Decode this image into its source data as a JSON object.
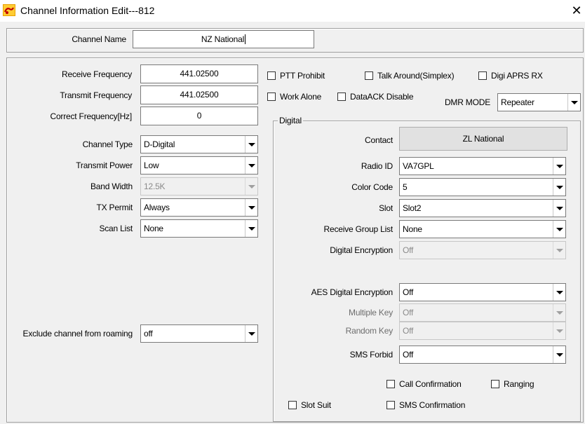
{
  "window": {
    "title": "Channel Information Edit---812",
    "close_glyph": "✕"
  },
  "channel_name": {
    "label": "Channel Name",
    "value": "NZ National"
  },
  "frequency": {
    "receive_label": "Receive Frequency",
    "receive_value": "441.02500",
    "transmit_label": "Transmit Frequency",
    "transmit_value": "441.02500",
    "correct_label": "Correct Frequency[Hz]",
    "correct_value": "0"
  },
  "left_combos": {
    "channel_type": {
      "label": "Channel Type",
      "value": "D-Digital"
    },
    "transmit_power": {
      "label": "Transmit Power",
      "value": "Low"
    },
    "band_width": {
      "label": "Band Width",
      "value": "12.5K"
    },
    "tx_permit": {
      "label": "TX Permit",
      "value": "Always"
    },
    "scan_list": {
      "label": "Scan List",
      "value": "None"
    },
    "exclude_roaming": {
      "label": "Exclude channel from roaming",
      "value": "off"
    }
  },
  "checkboxes": {
    "ptt_prohibit": "PTT Prohibit",
    "talk_around": "Talk Around(Simplex)",
    "digi_aprs_rx": "Digi APRS RX",
    "work_alone": "Work Alone",
    "dataack_disable": "DataACK Disable",
    "call_confirmation": "Call Confirmation",
    "ranging": "Ranging",
    "slot_suit": "Slot Suit",
    "sms_confirmation": "SMS Confirmation"
  },
  "dmr_mode": {
    "label": "DMR MODE",
    "value": "Repeater"
  },
  "digital": {
    "group_title": "Digital",
    "contact_label": "Contact",
    "contact_button": "ZL National",
    "radio_id": {
      "label": "Radio ID",
      "value": "VA7GPL"
    },
    "color_code": {
      "label": "Color Code",
      "value": "5"
    },
    "slot": {
      "label": "Slot",
      "value": "Slot2"
    },
    "receive_group_list": {
      "label": "Receive Group List",
      "value": "None"
    },
    "digital_encryption": {
      "label": "Digital Encryption",
      "value": "Off"
    },
    "aes_encryption": {
      "label": "AES Digital Encryption",
      "value": "Off"
    },
    "multiple_key": {
      "label": "Multiple Key",
      "value": "Off"
    },
    "random_key": {
      "label": "Random Key",
      "value": "Off"
    },
    "sms_forbid": {
      "label": "SMS Forbid",
      "value": "Off"
    }
  }
}
